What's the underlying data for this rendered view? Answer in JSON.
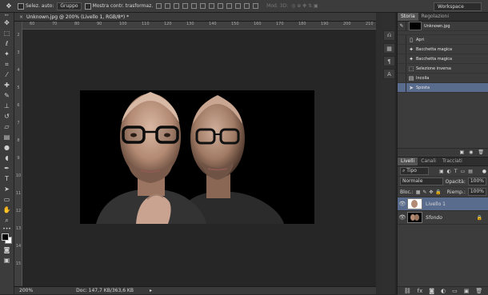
{
  "options_bar": {
    "auto_select_label": "Selez. auto:",
    "auto_select_value": "Gruppo",
    "show_transform_label": "Mostra contr. trasformaz.",
    "mode_3d_label": "Mod. 3D:",
    "workspace_label": "Workspace"
  },
  "document": {
    "tab_title": "Unknown.jpg @ 200% (Livello 1, RGB/8*) *",
    "zoom": "200%",
    "doc_info": "Doc: 147,7 KB/363,6 KB"
  },
  "ruler": {
    "top_ticks": [
      "60",
      "70",
      "80",
      "90",
      "100",
      "110",
      "120",
      "130",
      "140",
      "150",
      "160",
      "170",
      "180",
      "190",
      "200",
      "210"
    ],
    "left_ticks": [
      "2",
      "3",
      "4",
      "5",
      "6",
      "7",
      "8",
      "9",
      "10",
      "11",
      "12",
      "13",
      "14",
      "15"
    ]
  },
  "history_panel": {
    "tabs": [
      "Storia",
      "Regolazioni"
    ],
    "snapshot_label": "Unknown.jpg",
    "items": [
      {
        "label": "Apri",
        "icon": "document-icon"
      },
      {
        "label": "Bacchetta magica",
        "icon": "magic-wand-icon"
      },
      {
        "label": "Bacchetta magica",
        "icon": "magic-wand-icon"
      },
      {
        "label": "Selezione inversa",
        "icon": "selection-icon"
      },
      {
        "label": "Incolla",
        "icon": "paste-icon"
      },
      {
        "label": "Sposta",
        "icon": "move-icon"
      }
    ],
    "selected_index": 5
  },
  "layers_panel": {
    "tabs": [
      "Livelli",
      "Canali",
      "Tracciati"
    ],
    "filter_label": "Tipo",
    "blend_mode": "Normale",
    "opacity_label": "Opacità:",
    "opacity_value": "100%",
    "lock_label": "Bloc.:",
    "fill_label": "Riemp.:",
    "fill_value": "100%",
    "layers": [
      {
        "name": "Livello 1",
        "selected": true,
        "locked": false
      },
      {
        "name": "Sfondo",
        "selected": false,
        "locked": true
      }
    ]
  },
  "colors": {
    "ui_dark": "#262626",
    "panel": "#3c3c3c",
    "selection_highlight": "#5a6c8d"
  }
}
